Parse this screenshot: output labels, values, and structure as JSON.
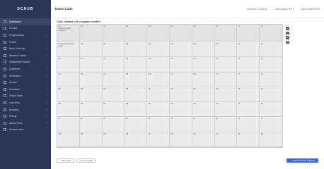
{
  "sidebar": {
    "logo": "DCNUB",
    "items": [
      {
        "label": "Dashboard"
      },
      {
        "label": "Groups"
      },
      {
        "label": "Programming"
      },
      {
        "label": "Orders"
      },
      {
        "label": "Mark Ordering"
      },
      {
        "label": "Needed Tracker"
      },
      {
        "label": "Satisfaction Review"
      },
      {
        "label": "Questions"
      },
      {
        "label": "Verification"
      },
      {
        "label": "Scores"
      },
      {
        "label": "Downtime"
      },
      {
        "label": "Watch Tasks"
      },
      {
        "label": "Last Meta"
      },
      {
        "label": "Analytics"
      },
      {
        "label": "Pricing"
      },
      {
        "label": "Admin Tools"
      },
      {
        "label": "Archive Users"
      }
    ]
  },
  "header": {
    "title": "Demo Labs",
    "right": [
      "Timezone: UTC/UTC",
      "Last location: 8% ▾",
      "Claim Settlement ▾"
    ]
  },
  "main": {
    "instruction": "Click channel cell to capture control",
    "grid": {
      "row0": [
        {
          "t": "A1",
          "n": "OpenUp Guard Together"
        },
        {
          "t": "B1",
          "n": ""
        },
        {
          "t": "C1",
          "n": ""
        },
        {
          "t": "D1",
          "n": ""
        },
        {
          "t": "E1",
          "n": ""
        },
        {
          "t": "F1",
          "n": ""
        },
        {
          "t": "G1",
          "n": ""
        },
        {
          "t": "H1",
          "n": ""
        },
        {
          "t": "I1",
          "n": ""
        },
        {
          "t": "J1",
          "n": ""
        }
      ],
      "row1": [
        "A2 OpenUp Guard Letter",
        "B2",
        "C2",
        "D2",
        "E2",
        "F2",
        "G2",
        "H2",
        "I2",
        "J2"
      ],
      "row2": [
        "A3",
        "B3",
        "C3",
        "D3",
        "E3",
        "F3",
        "G3",
        "H3",
        "I3",
        "J3"
      ],
      "row3": [
        "A4",
        "B4",
        "C4",
        "D4",
        "E4",
        "F4",
        "G4",
        "H4",
        "I4",
        "J4"
      ],
      "row4": [
        "A5",
        "B5",
        "C5",
        "D5",
        "E5",
        "F5",
        "G5",
        "H5",
        "I5",
        "J5"
      ],
      "row5": [
        "A6",
        "B6",
        "C6",
        "D6",
        "E6",
        "F6",
        "G6",
        "H6",
        "I6",
        "J6"
      ],
      "row6": [
        "A7",
        "B7",
        "C7",
        "D7",
        "E7",
        "F7",
        "G7",
        "H7",
        "I7",
        "J7"
      ],
      "row7": [
        "A8",
        "B8",
        "C8",
        "D8",
        "E8",
        "F8",
        "G8",
        "H8",
        "I8",
        "J8"
      ]
    },
    "tools": [
      "+",
      "−",
      "≡",
      "⊕"
    ],
    "footer": {
      "btn1": "← Prev Page",
      "btn2": "↑ Previous Step",
      "primary": "→ Submit channel selection"
    }
  }
}
